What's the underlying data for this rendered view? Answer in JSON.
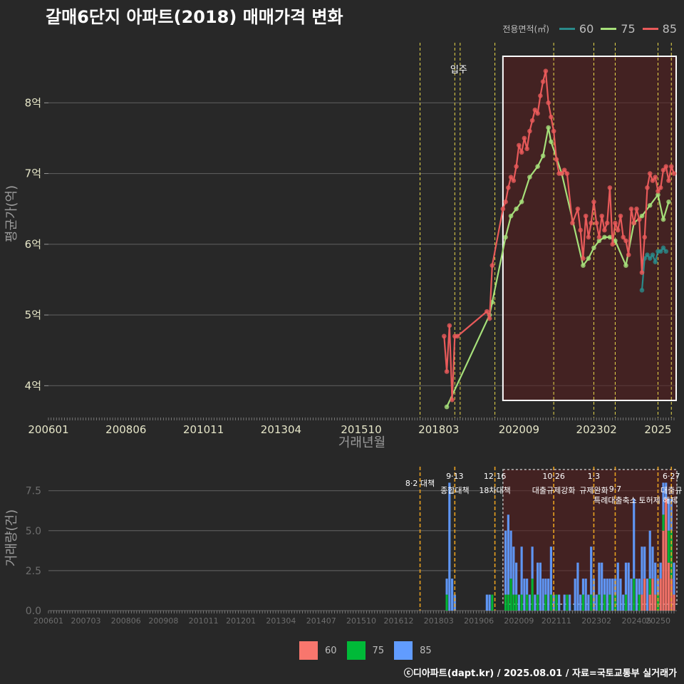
{
  "title": "갈매6단지 아파트(2018) 매매가격 변화",
  "footer": "ⓒ디아파트(dapt.kr) / 2025.08.01 / 자료=국토교통부 실거래가",
  "legend": {
    "title": "전용면적(㎡)",
    "lines": [
      {
        "label": "60",
        "color": "#2a8a8a"
      },
      {
        "label": "75",
        "color": "#a6e07a"
      },
      {
        "label": "85",
        "color": "#e85a5a"
      }
    ],
    "bars": [
      {
        "label": "60",
        "color": "#f8766d"
      },
      {
        "label": "75",
        "color": "#00ba38"
      },
      {
        "label": "85",
        "color": "#619cff"
      }
    ]
  },
  "chart_data": [
    {
      "type": "line",
      "title": "갈매6단지 아파트(2018) 매매가격 변화",
      "xlabel": "거래년월",
      "ylabel": "평균가(억)",
      "x_ticks": [
        "200601",
        "200806",
        "201011",
        "201304",
        "201510",
        "201803",
        "202009",
        "202302",
        "2025"
      ],
      "y_ticks": [
        "4억",
        "5억",
        "6억",
        "7억",
        "8억"
      ],
      "ylim": [
        3.55,
        8.9
      ],
      "grid": true,
      "annotation": "입주",
      "series": [
        {
          "name": "60",
          "color": "#2a8a8a",
          "x": [
            "2024-07",
            "2024-08",
            "2024-09",
            "2024-10",
            "2024-11",
            "2024-12",
            "2025-01",
            "2025-02",
            "2025-03",
            "2025-04"
          ],
          "y": [
            5.35,
            5.8,
            5.85,
            5.8,
            5.85,
            5.75,
            5.9,
            5.9,
            5.95,
            5.9
          ]
        },
        {
          "name": "75",
          "color": "#a6e07a",
          "x": [
            "2018-06",
            "2019-10",
            "2019-11",
            "2020-04",
            "2020-06",
            "2020-08",
            "2020-10",
            "2021-01",
            "2021-04",
            "2021-06",
            "2021-08",
            "2021-09",
            "2022-01",
            "2022-09",
            "2022-11",
            "2023-01",
            "2023-03",
            "2023-05",
            "2023-07",
            "2023-09",
            "2024-01",
            "2024-04",
            "2024-07",
            "2024-10",
            "2025-01",
            "2025-03",
            "2025-05"
          ],
          "y": [
            3.7,
            5.0,
            5.18,
            6.1,
            6.4,
            6.5,
            6.6,
            6.95,
            7.1,
            7.25,
            7.65,
            7.45,
            7.0,
            5.7,
            5.8,
            5.95,
            6.05,
            6.1,
            6.1,
            6.05,
            5.7,
            6.3,
            6.4,
            6.55,
            6.7,
            6.35,
            6.6
          ]
        },
        {
          "name": "85",
          "color": "#e85a5a",
          "x": [
            "2018-05",
            "2018-06",
            "2018-07",
            "2018-08",
            "2018-09",
            "2018-10",
            "2019-09",
            "2019-10",
            "2019-11",
            "2020-03",
            "2020-04",
            "2020-05",
            "2020-06",
            "2020-07",
            "2020-08",
            "2020-09",
            "2020-10",
            "2020-11",
            "2020-12",
            "2021-01",
            "2021-02",
            "2021-03",
            "2021-04",
            "2021-05",
            "2021-06",
            "2021-07",
            "2021-08",
            "2021-09",
            "2021-10",
            "2021-11",
            "2021-12",
            "2022-01",
            "2022-02",
            "2022-03",
            "2022-05",
            "2022-07",
            "2022-08",
            "2022-09",
            "2022-10",
            "2022-11",
            "2022-12",
            "2023-01",
            "2023-02",
            "2023-03",
            "2023-04",
            "2023-05",
            "2023-06",
            "2023-07",
            "2023-08",
            "2023-09",
            "2023-10",
            "2023-11",
            "2023-12",
            "2024-01",
            "2024-02",
            "2024-03",
            "2024-04",
            "2024-05",
            "2024-06",
            "2024-07",
            "2024-08",
            "2024-09",
            "2024-10",
            "2024-11",
            "2024-12",
            "2025-01",
            "2025-02",
            "2025-03",
            "2025-04",
            "2025-05",
            "2025-06",
            "2025-07"
          ],
          "y": [
            4.7,
            4.2,
            4.85,
            3.8,
            4.7,
            4.7,
            5.05,
            4.95,
            5.7,
            6.5,
            6.6,
            6.8,
            6.95,
            6.9,
            7.1,
            7.4,
            7.3,
            7.5,
            7.35,
            7.6,
            7.75,
            7.9,
            7.85,
            8.1,
            8.3,
            8.45,
            8.0,
            7.8,
            7.6,
            7.2,
            7.0,
            7.0,
            7.05,
            7.0,
            6.3,
            6.5,
            6.2,
            5.8,
            6.4,
            6.1,
            6.3,
            6.6,
            6.3,
            6.1,
            6.4,
            6.2,
            6.3,
            6.8,
            6.0,
            6.3,
            6.2,
            6.4,
            6.1,
            6.05,
            5.85,
            6.5,
            6.3,
            6.5,
            6.35,
            5.6,
            6.1,
            6.8,
            7.0,
            6.9,
            6.95,
            6.75,
            6.8,
            7.05,
            7.1,
            6.9,
            7.1,
            7.0
          ]
        }
      ]
    },
    {
      "type": "bar",
      "xlabel": "",
      "ylabel": "거래량(건)",
      "x_ticks": [
        "200601",
        "200703",
        "200806",
        "200908",
        "201011",
        "201201",
        "201304",
        "201407",
        "201510",
        "201612",
        "201803",
        "201906",
        "202009",
        "202111",
        "202302",
        "202405",
        "20250"
      ],
      "y_ticks": [
        "0.0",
        "2.5",
        "5.0",
        "7.5"
      ],
      "ylim": [
        0,
        9
      ],
      "grid": true,
      "policy_annotations": [
        {
          "date": "2017-08",
          "label": "8·2 대책"
        },
        {
          "date": "2018-09",
          "label": "9·13 종합대책"
        },
        {
          "date": "2019-12",
          "label": "12·16 18차대책"
        },
        {
          "date": "2021-10",
          "label": "10·26 대출규제강화"
        },
        {
          "date": "2023-01",
          "label": "1·3 규제완화"
        },
        {
          "date": "2023-09",
          "label": "9·7 특례대출축소"
        },
        {
          "date": "2025-01",
          "label": "토허제 해제"
        },
        {
          "date": "2025-06",
          "label": "6·27 대출규"
        }
      ],
      "series": [
        {
          "name": "60",
          "color": "#f8766d",
          "x": [
            "2024-07",
            "2024-08",
            "2024-09",
            "2024-10",
            "2024-11",
            "2024-12",
            "2025-01",
            "2025-02",
            "2025-03",
            "2025-04",
            "2025-05",
            "2025-06",
            "2025-07"
          ],
          "values": [
            1,
            2,
            0,
            1,
            2,
            1,
            0,
            2,
            5,
            7,
            3,
            2,
            1
          ]
        },
        {
          "name": "75",
          "color": "#00ba38",
          "x": [
            "2018-06",
            "2019-11",
            "2020-04",
            "2020-05",
            "2020-06",
            "2020-07",
            "2020-08",
            "2020-10",
            "2020-12",
            "2021-02",
            "2021-04",
            "2021-07",
            "2021-09",
            "2021-11",
            "2022-03",
            "2022-09",
            "2022-12",
            "2023-03",
            "2023-05",
            "2023-07",
            "2023-09",
            "2024-01",
            "2024-04",
            "2024-06",
            "2024-10",
            "2025-01",
            "2025-03",
            "2025-05",
            "2025-06"
          ],
          "values": [
            1,
            1,
            1,
            1,
            2,
            1,
            1,
            1,
            1,
            2,
            1,
            1,
            1,
            1,
            1,
            1,
            1,
            1,
            1,
            1,
            1,
            1,
            2,
            1,
            1,
            1,
            1,
            2,
            3
          ]
        },
        {
          "name": "85",
          "color": "#619cff",
          "x": [
            "2018-06",
            "2018-07",
            "2018-08",
            "2018-09",
            "2019-09",
            "2019-10",
            "2020-04",
            "2020-05",
            "2020-06",
            "2020-07",
            "2020-08",
            "2020-09",
            "2020-10",
            "2020-11",
            "2020-12",
            "2021-01",
            "2021-02",
            "2021-03",
            "2021-04",
            "2021-05",
            "2021-06",
            "2021-07",
            "2021-08",
            "2021-09",
            "2021-10",
            "2021-12",
            "2022-02",
            "2022-04",
            "2022-06",
            "2022-07",
            "2022-08",
            "2022-09",
            "2022-10",
            "2022-11",
            "2022-12",
            "2023-01",
            "2023-02",
            "2023-03",
            "2023-04",
            "2023-05",
            "2023-06",
            "2023-07",
            "2023-08",
            "2023-09",
            "2023-10",
            "2023-11",
            "2023-12",
            "2024-01",
            "2024-02",
            "2024-03",
            "2024-04",
            "2024-05",
            "2024-06",
            "2024-07",
            "2024-08",
            "2024-09",
            "2024-10",
            "2024-11",
            "2024-12",
            "2025-01",
            "2025-02",
            "2025-03",
            "2025-04",
            "2025-05",
            "2025-06",
            "2025-07"
          ],
          "values": [
            1,
            8,
            2,
            1,
            1,
            1,
            4,
            5,
            3,
            3,
            2,
            1,
            3,
            2,
            1,
            1,
            2,
            1,
            2,
            3,
            2,
            1,
            2,
            3,
            1,
            1,
            1,
            1,
            2,
            3,
            1,
            1,
            2,
            1,
            3,
            2,
            1,
            2,
            3,
            1,
            2,
            1,
            2,
            1,
            3,
            2,
            1,
            2,
            3,
            2,
            5,
            2,
            1,
            3,
            2,
            2,
            3,
            2,
            2,
            1,
            1,
            2,
            1,
            2,
            2,
            2
          ]
        }
      ]
    }
  ]
}
